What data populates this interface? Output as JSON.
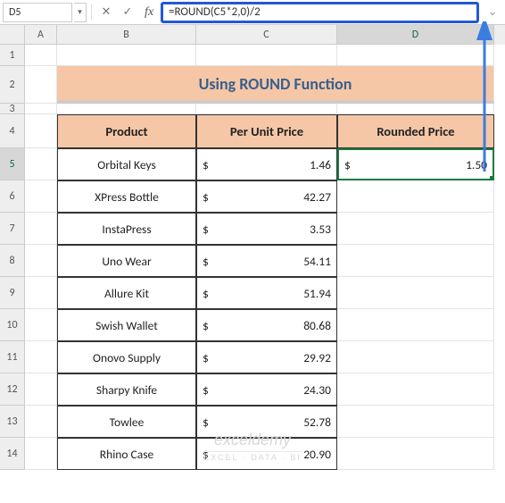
{
  "nameBox": "D5",
  "formula": "=ROUND(C5*2,0)/2",
  "columns": [
    "A",
    "B",
    "C",
    "D"
  ],
  "rows": [
    1,
    2,
    3,
    4,
    5,
    6,
    7,
    8,
    9,
    10,
    11,
    12,
    13,
    14
  ],
  "title": "Using ROUND Function",
  "headers": {
    "b": "Product",
    "c": "Per Unit Price",
    "d": "Rounded Price"
  },
  "data": [
    {
      "product": "Orbital Keys",
      "price": "1.46",
      "rounded": "1.50"
    },
    {
      "product": "XPress Bottle",
      "price": "42.27",
      "rounded": ""
    },
    {
      "product": "InstaPress",
      "price": "3.53",
      "rounded": ""
    },
    {
      "product": "Uno Wear",
      "price": "54.11",
      "rounded": ""
    },
    {
      "product": "Allure Kit",
      "price": "51.94",
      "rounded": ""
    },
    {
      "product": "Swish Wallet",
      "price": "80.68",
      "rounded": ""
    },
    {
      "product": "Onovo Supply",
      "price": "29.92",
      "rounded": ""
    },
    {
      "product": "Sharpy Knife",
      "price": "24.30",
      "rounded": ""
    },
    {
      "product": "Towlee",
      "price": "52.78",
      "rounded": ""
    },
    {
      "product": "Rhino Case",
      "price": "20.90",
      "rounded": ""
    }
  ],
  "currency": "$",
  "fx": {
    "fxLabel": "fx",
    "cancel": "✕",
    "confirm": "✓",
    "dd": "▾",
    "expand": "⌄"
  },
  "watermark": {
    "line1": "exceldemy",
    "line2": "EXCEL · DATA · BI"
  },
  "activeCell": {
    "col": "D",
    "row": 5
  }
}
